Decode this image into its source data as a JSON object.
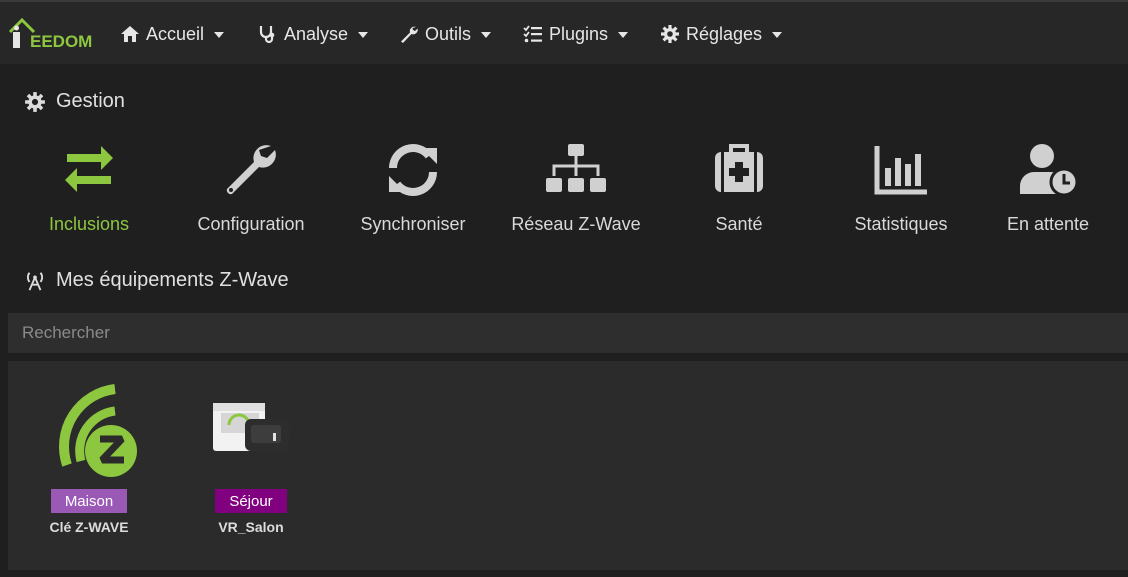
{
  "nav": {
    "logo_text": "EEDOM",
    "items": [
      {
        "label": "Accueil",
        "icon": "home-icon"
      },
      {
        "label": "Analyse",
        "icon": "stethoscope-icon"
      },
      {
        "label": "Outils",
        "icon": "wrench-icon"
      },
      {
        "label": "Plugins",
        "icon": "tasks-icon"
      },
      {
        "label": "Réglages",
        "icon": "gear-icon"
      }
    ]
  },
  "gestion": {
    "title": "Gestion",
    "items": [
      {
        "label": "Inclusions",
        "icon": "exchange-icon",
        "active": true
      },
      {
        "label": "Configuration",
        "icon": "wrench-icon"
      },
      {
        "label": "Synchroniser",
        "icon": "sync-icon"
      },
      {
        "label": "Réseau Z-Wave",
        "icon": "sitemap-icon"
      },
      {
        "label": "Santé",
        "icon": "medkit-icon"
      },
      {
        "label": "Statistiques",
        "icon": "bar-chart-icon"
      },
      {
        "label": "En attente",
        "icon": "user-clock-icon"
      }
    ]
  },
  "equipements": {
    "title": "Mes équipements Z-Wave",
    "search_placeholder": "Rechercher",
    "items": [
      {
        "badge": "Maison",
        "badge_color": "#9b59b6",
        "name": "Clé Z-WAVE",
        "image": "zwave-logo"
      },
      {
        "badge": "Séjour",
        "badge_color": "#800080",
        "name": "VR_Salon",
        "image": "roller-shutter-module"
      }
    ]
  },
  "colors": {
    "accent": "#8dc63f",
    "icon_gray": "#d0d0d0"
  }
}
